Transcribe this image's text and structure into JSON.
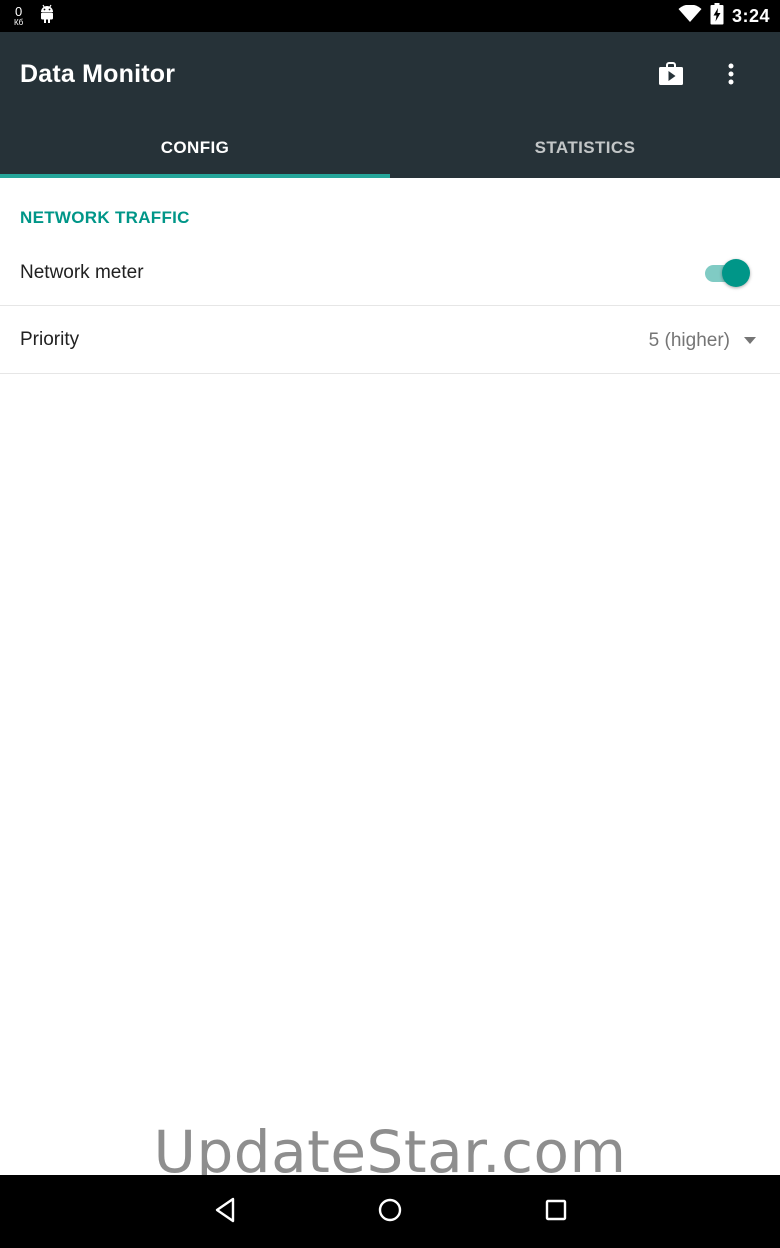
{
  "status_bar": {
    "data_counter": "0",
    "data_unit": "Кб",
    "time": "3:24",
    "icons": [
      "android-icon",
      "wifi-icon",
      "battery-charging-icon"
    ]
  },
  "app_bar": {
    "title": "Data Monitor",
    "actions": [
      "store-icon",
      "overflow-menu-icon"
    ]
  },
  "tabs": [
    {
      "label": "CONFIG",
      "active": true
    },
    {
      "label": "STATISTICS",
      "active": false
    }
  ],
  "content": {
    "section_title": "NETWORK TRAFFIC",
    "network_meter": {
      "label": "Network meter",
      "enabled": true
    },
    "priority": {
      "label": "Priority",
      "value": "5 (higher)"
    }
  },
  "watermark": "UpdateStar.com",
  "nav_bar": {
    "buttons": [
      "back-icon",
      "home-icon",
      "recents-icon"
    ]
  },
  "colors": {
    "app_bar": "#263238",
    "accent": "#009688",
    "tab_indicator": "#26a69a",
    "switch_track": "#80cbc4"
  }
}
